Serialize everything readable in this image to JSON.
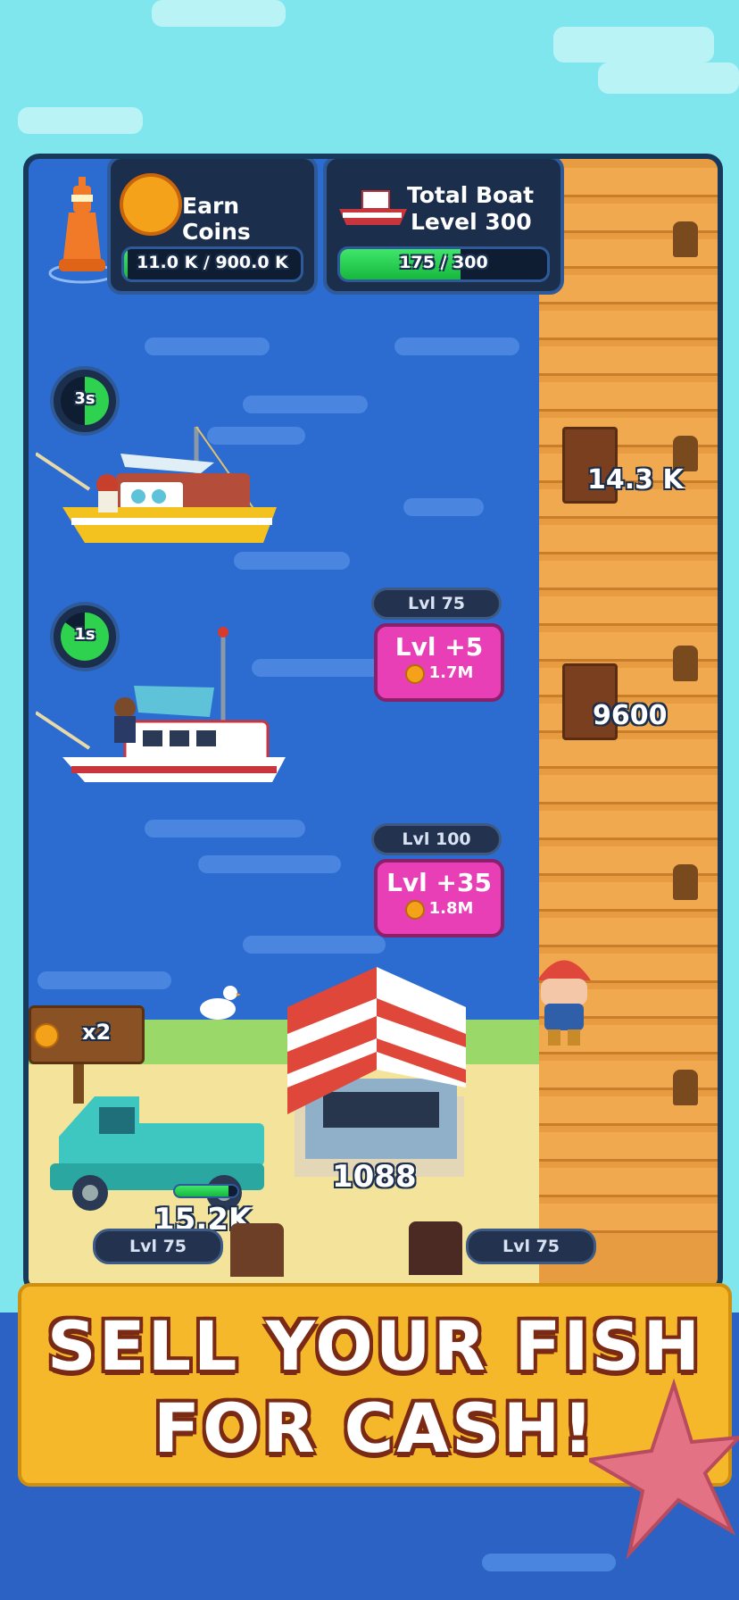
{
  "hud": {
    "coins": {
      "label": "Earn Coins",
      "progress_text": "11.0 K / 900.0 K",
      "progress": 0.012
    },
    "boat_level": {
      "label_line1": "Total Boat",
      "label_line2": "Level 300",
      "progress_text": "175 / 300",
      "progress": 0.583
    }
  },
  "boats": [
    {
      "timer": "3s",
      "timer_progress": 0.5,
      "level": "Lvl 75",
      "upgrade_label": "Lvl +5",
      "upgrade_cost": "1.7M",
      "catch_value": "14.3 K"
    },
    {
      "timer": "1s",
      "timer_progress": 0.85,
      "level": "Lvl 100",
      "upgrade_label": "Lvl +35",
      "upgrade_cost": "1.8M",
      "catch_value": "9600"
    }
  ],
  "shore": {
    "sign_multiplier": "x2",
    "truck_value": "15.2K",
    "market_value": "1088",
    "left_worker_level": "Lvl 75",
    "right_worker_level": "Lvl 75"
  },
  "banner": {
    "line1": "SELL YOUR FISH",
    "line2": "FOR CASH!"
  },
  "colors": {
    "sea": "#2c6bd0",
    "dock": "#e79c42",
    "accent": "#e93fb6",
    "banner": "#f4b82a"
  }
}
